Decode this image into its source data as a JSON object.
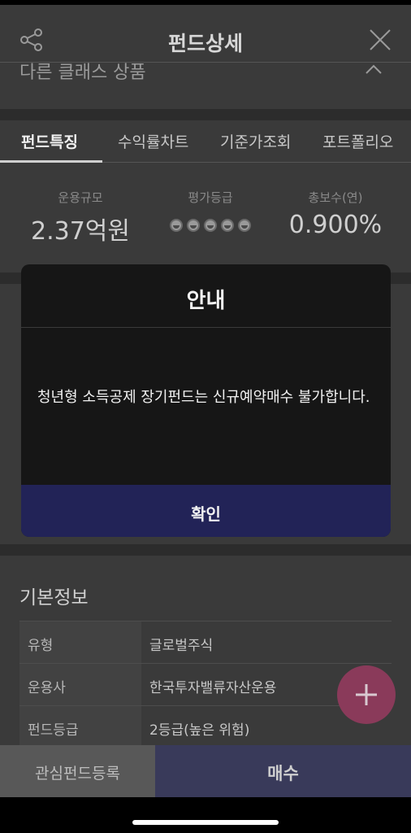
{
  "header": {
    "title": "펀드상세",
    "share_icon": "share-icon",
    "close_icon": "close-icon"
  },
  "subbar": {
    "text": "다른 클래스 상품",
    "chevron_icon": "chevron-up-icon"
  },
  "tabs": [
    {
      "label": "펀드특징",
      "active": true
    },
    {
      "label": "수익률차트",
      "active": false
    },
    {
      "label": "기준가조회",
      "active": false
    },
    {
      "label": "포트폴리오",
      "active": false
    }
  ],
  "stats": {
    "aum": {
      "label": "운용규모",
      "value": "2.37억원"
    },
    "grade": {
      "label": "평가등급",
      "dots": 5
    },
    "fee": {
      "label": "총보수(연)",
      "value": "0.900%"
    }
  },
  "info": {
    "title": "기본정보",
    "rows": [
      {
        "key": "유형",
        "value": "글로벌주식"
      },
      {
        "key": "운용사",
        "value": "한국투자밸류자산운용"
      },
      {
        "key": "펀드등급",
        "value": "2등급(높은 위험)"
      }
    ]
  },
  "fab": {
    "icon": "plus-icon",
    "color": "#8a3a5a"
  },
  "bottom_bar": {
    "favorite_label": "관심펀드등록",
    "buy_label": "매수"
  },
  "dialog": {
    "title": "안내",
    "message": "청년형 소득공제 장기펀드는 신규예약매수 불가합니다.",
    "confirm_label": "확인",
    "confirm_color": "#222357"
  }
}
